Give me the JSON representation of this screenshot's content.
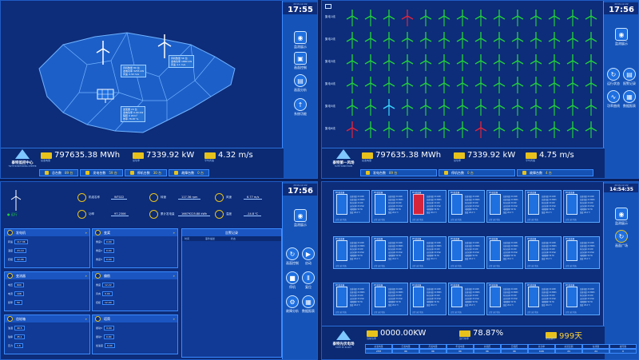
{
  "q1": {
    "clock": {
      "date": "2019-12-02",
      "time": "17:55"
    },
    "rail": [
      "监测展示",
      "画面控制",
      "画面分析",
      "系统功能"
    ],
    "map_labels": [
      {
        "lines": [
          "风机数量   89 台",
          "发电功率   3255 kW",
          "风速   4.32 m/s"
        ]
      },
      {
        "lines": [
          "风机数量   56 台",
          "发电功率   1880 kW",
          "风速   4.1 m/s"
        ]
      },
      {
        "lines": [
          "逆变器   24 台",
          "发电功率   0.00 kW",
          "辐照   0 W/m²",
          "效率   78.87 %"
        ]
      }
    ],
    "logo": {
      "name": "泰特监控中心",
      "sub": "TAITE MONITORING CENTER"
    },
    "kpis": [
      {
        "label": "总发电量",
        "value": "797635.38 MWh"
      },
      {
        "label": "总功率",
        "value": "7339.92 kW"
      },
      {
        "label": "平均风速",
        "value": "4.32 m/s"
      }
    ],
    "tabs": [
      {
        "label": "总台数",
        "value": "89 台"
      },
      {
        "label": "发电台数",
        "value": "59 台"
      },
      {
        "label": "停机台数",
        "value": "30 台"
      },
      {
        "label": "故障台数",
        "value": "0 台"
      }
    ],
    "colors": {
      "ok": "#21d03a",
      "fault": "#e0243a",
      "idle": "#3ad8ff"
    }
  },
  "q2": {
    "clock": {
      "date": "2019-12-02",
      "time": "17:56"
    },
    "rail": [
      "监测展示",
      "运行状态",
      "报警记录",
      "功率曲线",
      "数据报表"
    ],
    "rows": [
      "集电1线",
      "集电2线",
      "集电3线",
      "集电4线",
      "集电5线",
      "集电6线"
    ],
    "turbine_status": [
      [
        "ok",
        "ok",
        "ok",
        "fault",
        "ok",
        "ok",
        "ok",
        "ok",
        "ok",
        "ok",
        "ok",
        "ok",
        "ok",
        "ok"
      ],
      [
        "ok",
        "ok",
        "ok",
        "ok",
        "ok",
        "ok",
        "ok",
        "ok",
        "ok",
        "ok",
        "ok",
        "ok",
        "ok",
        "ok"
      ],
      [
        "ok",
        "ok",
        "ok",
        "ok",
        "ok",
        "ok",
        "ok",
        "ok",
        "ok",
        "ok",
        "ok",
        "ok",
        "ok",
        "ok"
      ],
      [
        "ok",
        "ok",
        "ok",
        "ok",
        "ok",
        "ok",
        "ok",
        "ok",
        "ok",
        "ok",
        "ok",
        "ok",
        "ok",
        "ok"
      ],
      [
        "ok",
        "ok",
        "idle",
        "ok",
        "ok",
        "ok",
        "ok",
        "ok",
        "ok",
        "ok",
        "ok",
        "ok",
        "ok",
        "ok"
      ],
      [
        "fault",
        "ok",
        "ok",
        "ok",
        "ok",
        "ok",
        "ok",
        "fault",
        "ok",
        "ok",
        "ok",
        "ok",
        "ok",
        "ok"
      ]
    ],
    "logo": {
      "name": "泰特第一风场",
      "sub": "TAITE WIND FARM"
    },
    "kpis": [
      {
        "label": "总发电量",
        "value": "797635.38 MWh"
      },
      {
        "label": "总功率",
        "value": "7339.92 kW"
      },
      {
        "label": "平均风速",
        "value": "4.75 m/s"
      }
    ],
    "tabs": [
      {
        "label": "发电台数",
        "value": "89 台"
      },
      {
        "label": "停机台数",
        "value": "0 台"
      },
      {
        "label": "故障台数",
        "value": "4 台"
      }
    ]
  },
  "q3": {
    "clock": {
      "date": "2019-12-02",
      "time": "17:56"
    },
    "status": "运行",
    "top": [
      {
        "label": "机组名称",
        "value": "WT022"
      },
      {
        "label": "转速",
        "value": "117.36 rpm"
      },
      {
        "label": "风速",
        "value": "6.77 m/s"
      },
      {
        "label": "功率",
        "value": "97.2306"
      },
      {
        "label": "累计发电量",
        "value": "16679225.88 kWh"
      },
      {
        "label": "温度",
        "value": "-14.8 ℃"
      }
    ],
    "panels": [
      {
        "title": "发电机",
        "rows": [
          [
            "转速",
            "117.36"
          ],
          [
            "温度",
            "23.19"
          ],
          [
            "绕组",
            "12.46"
          ]
        ]
      },
      {
        "title": "变桨",
        "rows": [
          [
            "角度1",
            "0.00"
          ],
          [
            "角度2",
            "0.00"
          ],
          [
            "角度3",
            "0.00"
          ]
        ]
      },
      {
        "title": "变流器",
        "rows": [
          [
            "电压",
            "690"
          ],
          [
            "电流",
            "108"
          ],
          [
            "频率",
            "50"
          ]
        ]
      },
      {
        "title": "偏航",
        "rows": [
          [
            "角度",
            "12.22"
          ],
          [
            "风向",
            "0.00"
          ],
          [
            "扭缆",
            "12.00"
          ]
        ]
      },
      {
        "title": "齿轮箱",
        "rows": [
          [
            "油温",
            "40.5"
          ],
          [
            "轴承",
            "45.1"
          ],
          [
            "压力",
            "1.6"
          ]
        ]
      },
      {
        "title": "塔筒",
        "rows": [
          [
            "振动X",
            "0.00"
          ],
          [
            "振动Y",
            "0.00"
          ],
          [
            "加速度",
            "0.00"
          ]
        ]
      }
    ],
    "record": {
      "title": "告警记录",
      "cols": [
        "时间",
        "事件描述",
        "状态"
      ]
    },
    "rail": [
      "监测展示",
      "画面控制",
      "启动",
      "停机",
      "复位",
      "故障分析",
      "数据报表"
    ]
  },
  "q4": {
    "clock": {
      "date": "2019-12-02",
      "time": "14:54:35"
    },
    "rail": [
      "监测展示",
      "画面广场"
    ],
    "inverter_header": "#1逆变器",
    "inverter_lines": [
      "日发电量 XX kWh",
      "总发电量 XX MWh",
      "有功功率 XX kW",
      "无功功率 XX kVar",
      "电网频率 50 Hz",
      "温度 26.4 ℃"
    ],
    "inverter_footer": "正常 运行状态",
    "inverter_status": [
      [
        "ok",
        "ok",
        "fault",
        "ok",
        "ok",
        "ok",
        "ok"
      ],
      [
        "ok",
        "ok",
        "ok",
        "ok",
        "ok",
        "ok",
        "ok"
      ],
      [
        "ok",
        "ok",
        "ok",
        "ok",
        "ok",
        "ok",
        "ok"
      ]
    ],
    "logo": {
      "name": "泰特光伏电场",
      "sub": "TAITE PV PLANT"
    },
    "kpis": [
      {
        "label": "当前功率",
        "value": "0000.00KW"
      },
      {
        "label": "运行效率",
        "value": "78.87%"
      },
      {
        "label": "安全运行",
        "value": "999天"
      }
    ],
    "stats": {
      "headers": [
        "总发电量",
        "日发电量",
        "月发电量",
        "年发电量",
        "总辐照",
        "日辐照",
        "总功率",
        "总逆变器",
        "在线数",
        "故障数"
      ],
      "values": [
        "27M",
        "0K",
        "0K",
        "0K",
        "0K",
        "0K",
        "0.0K",
        "24",
        "24",
        "0"
      ]
    }
  }
}
